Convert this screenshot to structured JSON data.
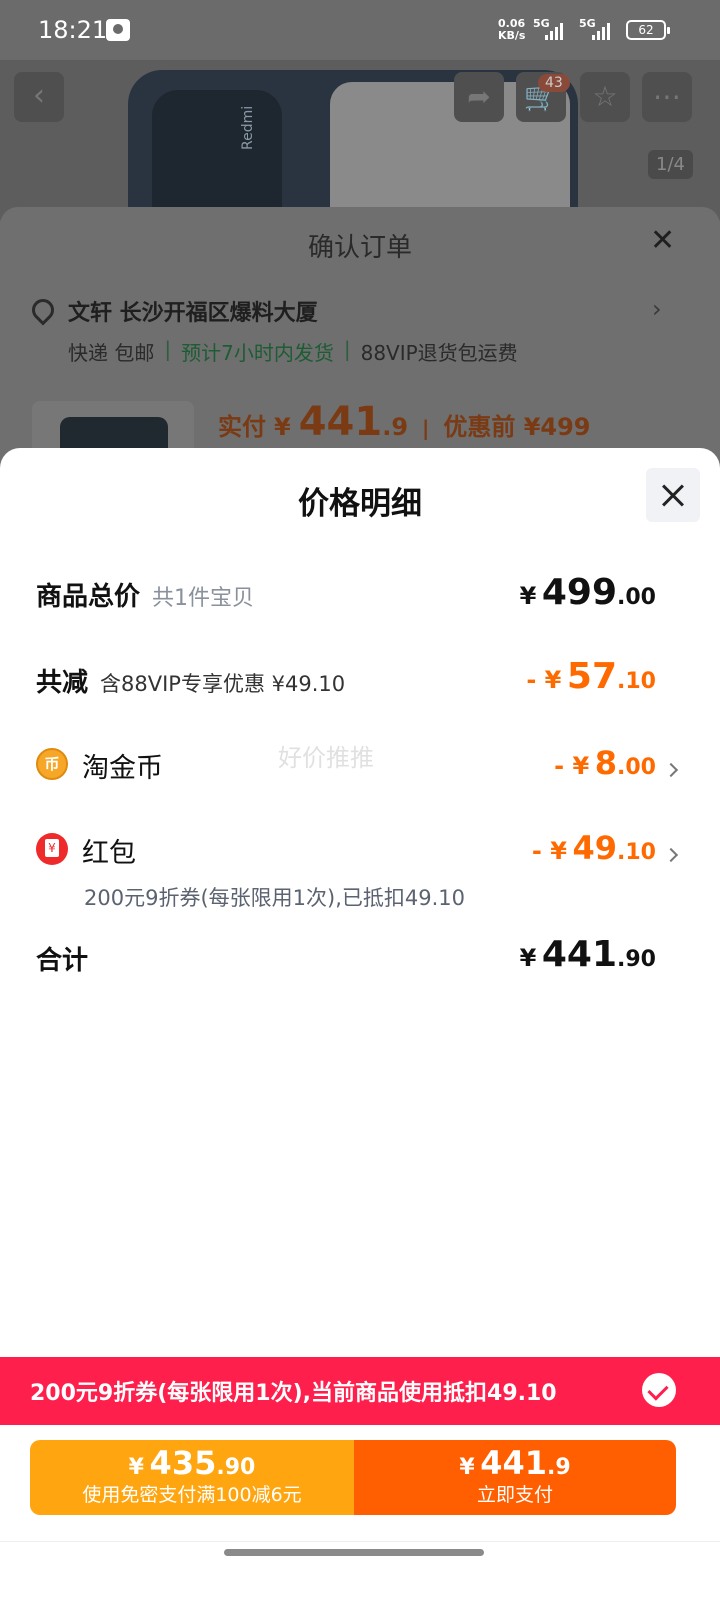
{
  "status_bar": {
    "time": "18:21",
    "net_speed_value": "0.06",
    "net_speed_unit": "KB/s",
    "sim1": "5G",
    "sim2": "5G",
    "battery": "62"
  },
  "product_header": {
    "brand": "Redmi",
    "cart_count": "43",
    "image_counter": "1/4"
  },
  "order": {
    "title": "确认订单",
    "address": "文轩 长沙开福区爆料大厦",
    "delivery_method": "快递 包邮",
    "delivery_estimate": "预计7小时内发货",
    "return_service": "88VIP退货包运费",
    "paid_label": "实付",
    "paid_symbol": "¥",
    "paid_int": "441",
    "paid_dec": ".9",
    "before_discount": "优惠前 ¥499"
  },
  "price_detail": {
    "title": "价格明细",
    "total": {
      "label": "商品总价",
      "sub": "共1件宝贝",
      "symbol": "¥",
      "int": "499",
      "dec": ".00"
    },
    "discount": {
      "label": "共减",
      "sub": "含88VIP专享优惠 ¥49.10",
      "prefix": "- ¥",
      "int": "57",
      "dec": ".10"
    },
    "coin": {
      "label": "淘金币",
      "icon_text": "币",
      "prefix": "- ¥",
      "int": "8",
      "dec": ".00"
    },
    "hongbao": {
      "label": "红包",
      "prefix": "- ¥",
      "int": "49",
      "dec": ".10",
      "desc": "200元9折券(每张限用1次),已抵扣49.10"
    },
    "sum": {
      "label": "合计",
      "symbol": "¥",
      "int": "441",
      "dec": ".90"
    },
    "watermark": "好价推推"
  },
  "coupon_bar": {
    "text": "200元9折券(每张限用1次),当前商品使用抵扣49.10"
  },
  "pay": {
    "left": {
      "symbol": "¥",
      "int": "435",
      "dec": ".90",
      "sub": "使用免密支付满100减6元"
    },
    "right": {
      "symbol": "¥",
      "int": "441",
      "dec": ".9",
      "sub": "立即支付"
    }
  },
  "colors": {
    "accent_orange": "#ff6a00",
    "coupon_red": "#ff1f4d",
    "pay_left": "#ffa510",
    "pay_right": "#ff5f00"
  }
}
